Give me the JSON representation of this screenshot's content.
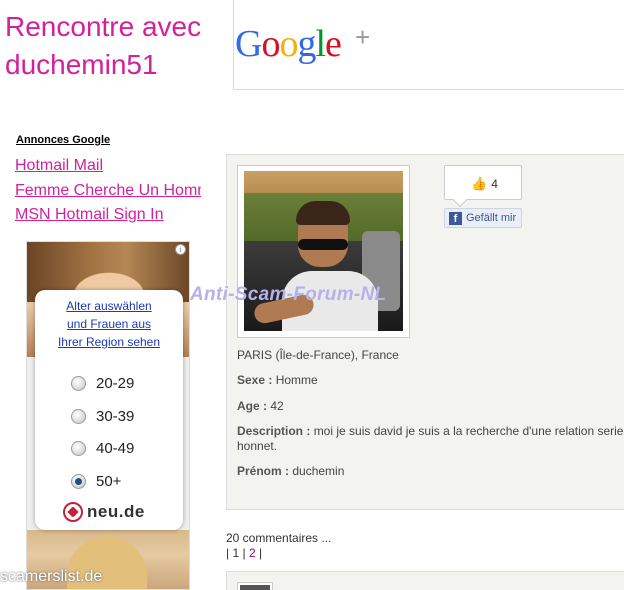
{
  "header": {
    "title": "Rencontre avec duchemin51",
    "google_plus": {
      "letters": [
        "G",
        "o",
        "o",
        "g",
        "l",
        "e"
      ],
      "colors": [
        "#3369e8",
        "#d50f25",
        "#eeb211",
        "#3369e8",
        "#009925",
        "#d50f25"
      ],
      "plus": "+"
    }
  },
  "ads": {
    "heading": "Annonces Google",
    "links": [
      "Hotmail Mail",
      "Femme Cherche Un Homme",
      "MSN Hotmail Sign In"
    ]
  },
  "banner": {
    "info_icon": "i",
    "cta": [
      "Alter auswählen",
      "und Frauen aus",
      "Ihrer Region sehen"
    ],
    "age_options": [
      {
        "label": "20-29",
        "checked": false
      },
      {
        "label": "30-39",
        "checked": false
      },
      {
        "label": "40-49",
        "checked": false
      },
      {
        "label": "50+",
        "checked": true
      }
    ],
    "brand": "neu.de"
  },
  "profile": {
    "likes": "4",
    "like_button": "Gefällt mir",
    "location": "PARIS (Île-de-France), France",
    "sexe_label": "Sexe :",
    "sexe_value": "Homme",
    "age_label": "Age :",
    "age_value": "42",
    "description_label": "Description :",
    "description_line1": "moi je suis david je suis a la recherche d'une relation serieuse",
    "description_line2": "honnet.",
    "prenom_label": "Prénom :",
    "prenom_value": "duchemin"
  },
  "comments": {
    "count_text": "20 commentaires ...",
    "pages": [
      "1",
      "2"
    ],
    "active_page": "2"
  },
  "watermarks": {
    "forum": "Anti-Scam-Forum-NL",
    "site": "scamerslist.de"
  }
}
